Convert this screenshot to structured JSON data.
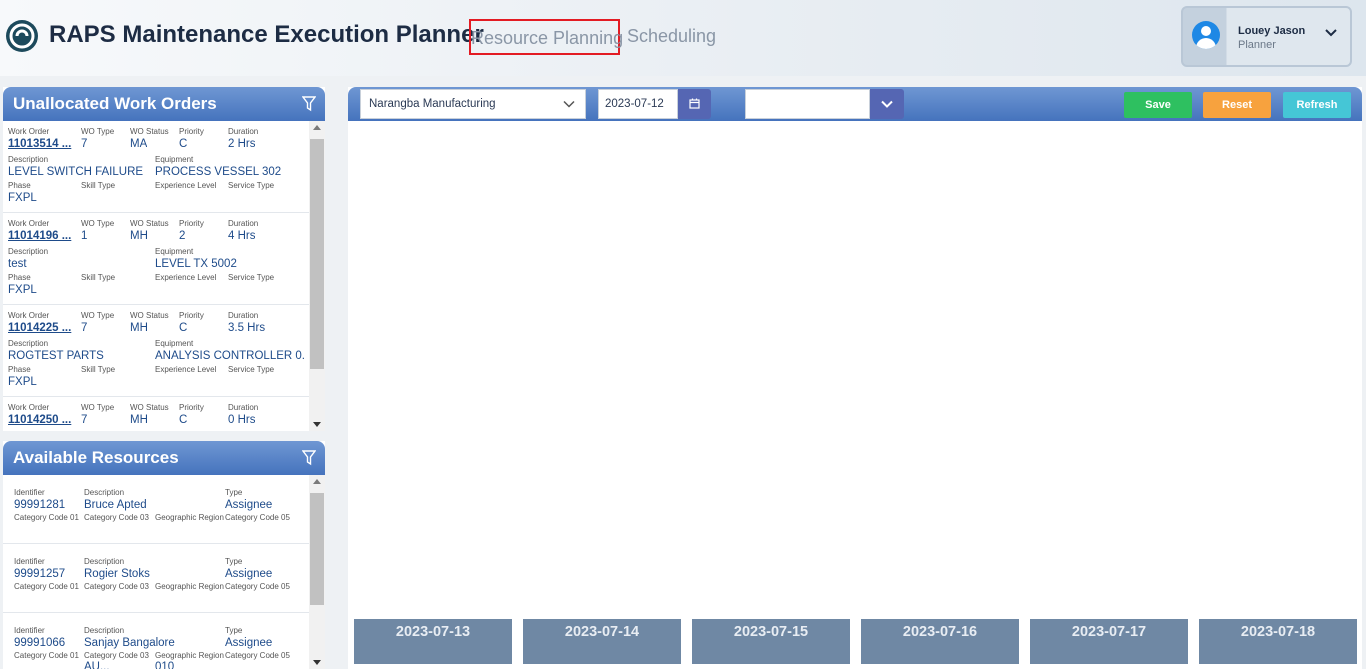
{
  "header": {
    "title": "RAPS Maintenance Execution Planner",
    "tabs": [
      "Resource Planning",
      "Scheduling"
    ],
    "user": {
      "name": "Louey Jason",
      "role": "Planner"
    }
  },
  "work_orders_panel": {
    "title": "Unallocated Work Orders",
    "labels": {
      "work_order": "Work Order",
      "wo_type": "WO Type",
      "wo_status": "WO Status",
      "priority": "Priority",
      "duration": "Duration",
      "description": "Description",
      "equipment": "Equipment",
      "phase": "Phase",
      "skill_type": "Skill Type",
      "experience_level": "Experience Level",
      "service_type": "Service Type"
    },
    "items": [
      {
        "work_order": "11013514 ...",
        "wo_type": "7",
        "wo_status": "MA",
        "priority": "C",
        "duration": "2 Hrs",
        "description": "LEVEL SWITCH FAILURE",
        "equipment": "PROCESS VESSEL 302",
        "phase": "FXPL"
      },
      {
        "work_order": "11014196 ...",
        "wo_type": "1",
        "wo_status": "MH",
        "priority": "2",
        "duration": "4 Hrs",
        "description": "test",
        "equipment": "LEVEL TX 5002",
        "phase": "FXPL"
      },
      {
        "work_order": "11014225 ...",
        "wo_type": "7",
        "wo_status": "MH",
        "priority": "C",
        "duration": "3.5 Hrs",
        "description": "ROGTEST PARTS",
        "equipment": "ANALYSIS CONTROLLER 0...",
        "phase": "FXPL"
      },
      {
        "work_order": "11014250 ...",
        "wo_type": "7",
        "wo_status": "MH",
        "priority": "C",
        "duration": "0 Hrs",
        "description": "",
        "equipment": "",
        "phase": ""
      }
    ]
  },
  "resources_panel": {
    "title": "Available Resources",
    "labels": {
      "identifier": "Identifier",
      "description": "Description",
      "type": "Type",
      "cat1": "Category Code 01",
      "cat3": "Category Code 03",
      "geo": "Geographic Region",
      "cat5": "Category Code 05"
    },
    "items": [
      {
        "identifier": "99991281",
        "description": "Bruce Apted",
        "type": "Assignee",
        "cat3_val": "",
        "geo_val": ""
      },
      {
        "identifier": "99991257",
        "description": "Rogier Stoks",
        "type": "Assignee",
        "cat3_val": "",
        "geo_val": ""
      },
      {
        "identifier": "99991066",
        "description": "Sanjay Bangalore",
        "type": "Assignee",
        "cat3_val": "AU...",
        "geo_val": "010"
      }
    ]
  },
  "toolbar": {
    "site": "Narangba Manufacturing",
    "date": "2023-07-12",
    "save_label": "Save",
    "reset_label": "Reset",
    "refresh_label": "Refresh"
  },
  "days": [
    "2023-07-13",
    "2023-07-14",
    "2023-07-15",
    "2023-07-16",
    "2023-07-17",
    "2023-07-18"
  ],
  "colors": {
    "accent": "#4573bd",
    "save": "#2ec060",
    "reset": "#f7a23e",
    "refresh": "#45c6d6",
    "active_tab_border": "#e31b23"
  }
}
